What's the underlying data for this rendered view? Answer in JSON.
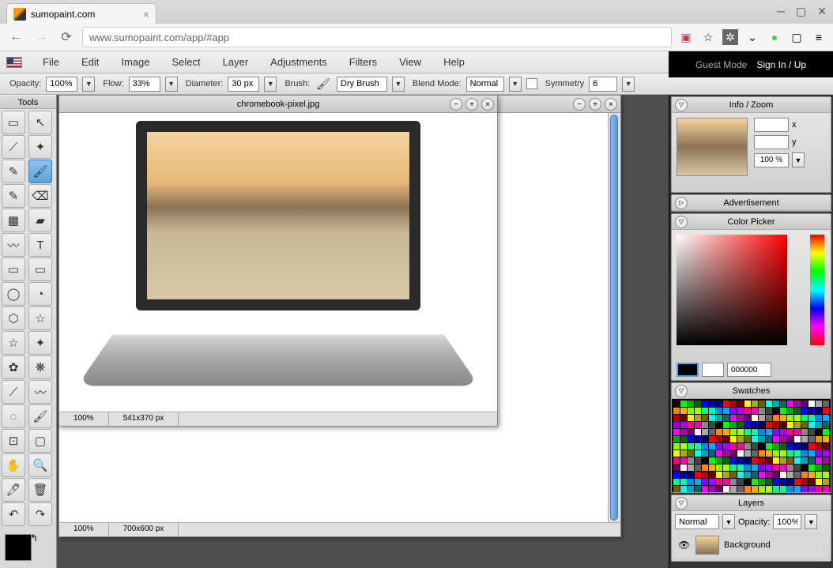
{
  "browser": {
    "tab_title": "sumopaint.com",
    "url": "www.sumopaint.com/app/#app"
  },
  "menu": {
    "items": [
      "File",
      "Edit",
      "Image",
      "Select",
      "Layer",
      "Adjustments",
      "Filters",
      "View",
      "Help"
    ]
  },
  "auth": {
    "guest": "Guest Mode",
    "signin": "Sign In / Up"
  },
  "options": {
    "opacity_label": "Opacity:",
    "opacity_value": "100%",
    "flow_label": "Flow:",
    "flow_value": "33%",
    "diameter_label": "Diameter:",
    "diameter_value": "30 px",
    "brush_label": "Brush:",
    "brush_value": "Dry Brush",
    "blend_label": "Blend Mode:",
    "blend_value": "Normal",
    "symmetry_label": "Symmetry",
    "symmetry_value": "6"
  },
  "tools_panel": {
    "title": "Tools"
  },
  "tool_names": [
    "marquee",
    "move",
    "lasso",
    "magic-wand",
    "eyedropper",
    "brush",
    "pencil",
    "eraser",
    "gradient",
    "paint-bucket",
    "smudge",
    "text",
    "rectangle",
    "rounded-rect",
    "ellipse",
    "pie",
    "polygon",
    "star",
    "custom-star",
    "star2",
    "blob",
    "symmetry",
    "line",
    "curve",
    "blur",
    "sharpen",
    "crop",
    "transform",
    "hand",
    "zoom",
    "dodge",
    "burn",
    "undo",
    "redo"
  ],
  "tool_glyphs": [
    "▭",
    "↖",
    "⟋",
    "✦",
    "✎",
    "🖌",
    "✎",
    "⌫",
    "▦",
    "▰",
    "〰",
    "T",
    "▭",
    "▭",
    "◯",
    "◔",
    "⬡",
    "☆",
    "☆",
    "✦",
    "✿",
    "❋",
    "⟋",
    "〰",
    "◌",
    "🖌",
    "⊡",
    "▢",
    "✋",
    "🔍",
    "🖊",
    "🗑",
    "↶",
    "↷"
  ],
  "doc": {
    "front_title": "chromebook-pixel.jpg",
    "front_zoom": "100%",
    "front_dims": "541x370 px",
    "back_zoom": "100%",
    "back_dims": "700x600 px"
  },
  "panels": {
    "info": {
      "title": "Info / Zoom",
      "x_label": "x",
      "y_label": "y",
      "zoom": "100 %"
    },
    "ad": {
      "title": "Advertisement"
    },
    "colorpicker": {
      "title": "Color Picker",
      "hex": "000000"
    },
    "swatches": {
      "title": "Swatches"
    },
    "layers": {
      "title": "Layers",
      "blend": "Normal",
      "opacity_label": "Opacity:",
      "opacity_value": "100%",
      "background_label": "Background"
    }
  }
}
